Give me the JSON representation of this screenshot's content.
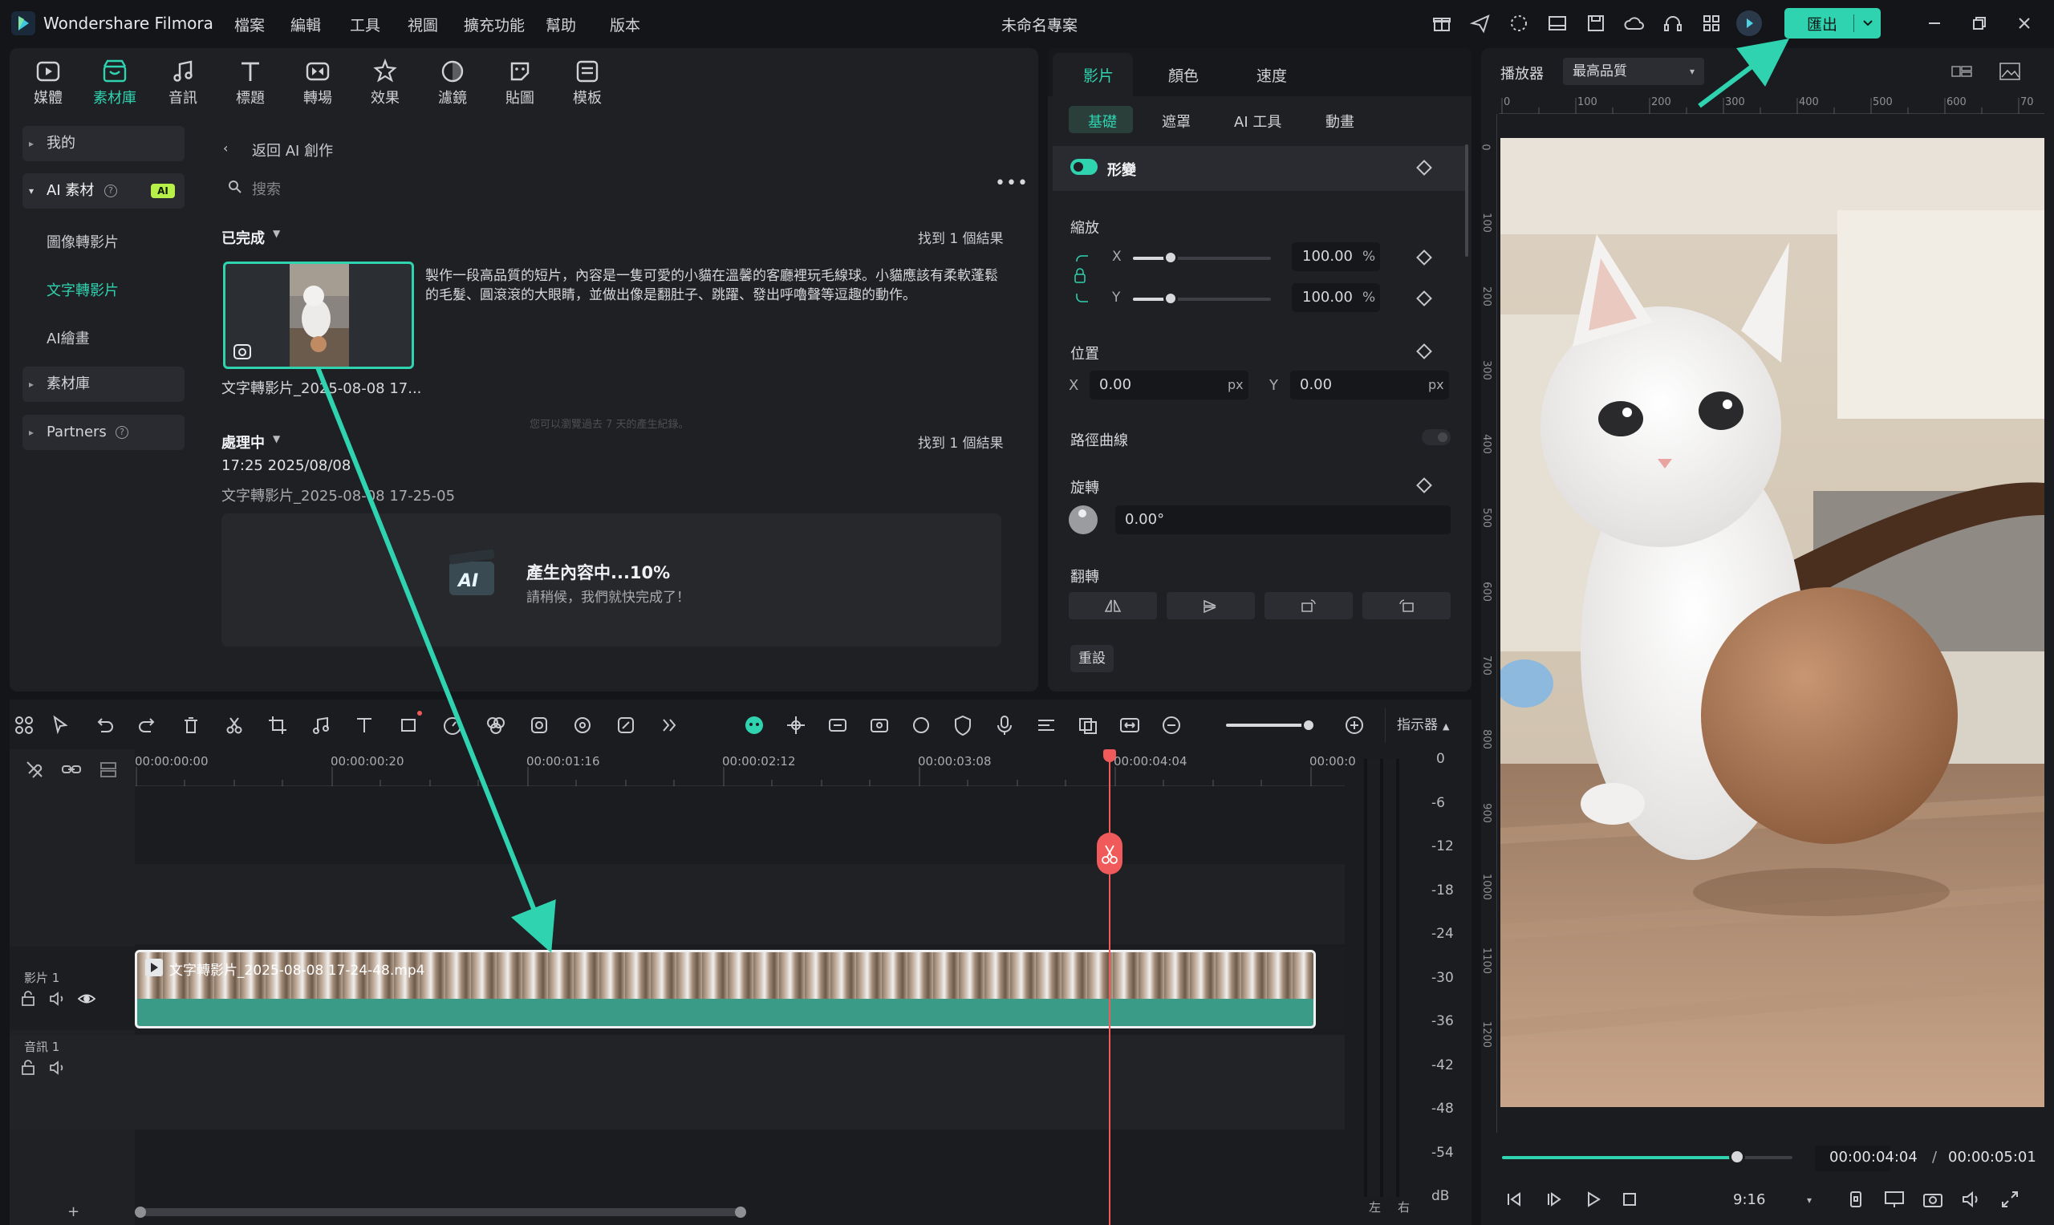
{
  "app": {
    "name": "Wondershare Filmora",
    "project_title": "未命名專案",
    "export_label": "匯出"
  },
  "menu": [
    "檔案",
    "編輯",
    "工具",
    "視圖",
    "擴充功能",
    "幫助",
    "版本"
  ],
  "toolbar": [
    {
      "label": "媒體",
      "icon": "media-icon"
    },
    {
      "label": "素材庫",
      "icon": "stock-icon",
      "active": true
    },
    {
      "label": "音訊",
      "icon": "music-icon"
    },
    {
      "label": "標題",
      "icon": "title-icon"
    },
    {
      "label": "轉場",
      "icon": "transition-icon"
    },
    {
      "label": "效果",
      "icon": "effects-icon"
    },
    {
      "label": "濾鏡",
      "icon": "filter-icon"
    },
    {
      "label": "貼圖",
      "icon": "sticker-icon"
    },
    {
      "label": "模板",
      "icon": "template-icon"
    }
  ],
  "sidebar": {
    "mine": "我的",
    "ai_assets": "AI 素材",
    "ai_badge": "AI",
    "subitems": [
      "圖像轉影片",
      "文字轉影片",
      "AI繪畫"
    ],
    "library": "素材庫",
    "partners": "Partners"
  },
  "library": {
    "back_label": "返回 AI 創作",
    "search_placeholder": "搜索",
    "completed_label": "已完成",
    "completed_count": "找到 1 個結果",
    "prompt": "製作一段高品質的短片，內容是一隻可愛的小貓在溫馨的客廳裡玩毛線球。小貓應該有柔軟蓬鬆的毛髮、圓滾滾的大眼睛，並做出像是翻肚子、跳躍、發出呼嚕聲等逗趣的動作。",
    "thumb_caption": "文字轉影片_2025-08-08 17...",
    "history_note": "您可以瀏覽過去 7 天的產生紀錄。",
    "processing_label": "處理中",
    "processing_count": "找到 1 個結果",
    "processing_time": "17:25 2025/08/08",
    "processing_name": "文字轉影片_2025-08-08 17-25-05",
    "progress_title": "產生內容中...10%",
    "progress_percent": 10,
    "progress_sub": "請稍候，我們就快完成了！",
    "ai_logo_text": "AI"
  },
  "properties": {
    "tabs": [
      "影片",
      "顏色",
      "速度"
    ],
    "subtabs": [
      "基礎",
      "遮罩",
      "AI 工具",
      "動畫"
    ],
    "transform_label": "形變",
    "scale_label": "縮放",
    "scale_x": "100.00",
    "scale_y": "100.00",
    "percent_unit": "%",
    "position_label": "位置",
    "pos_x": "0.00",
    "pos_y": "0.00",
    "px_unit": "px",
    "x_label": "X",
    "y_label": "Y",
    "path_curve_label": "路徑曲線",
    "rotation_label": "旋轉",
    "rotation_value": "0.00°",
    "flip_label": "翻轉",
    "reset_label": "重設"
  },
  "player": {
    "label": "播放器",
    "quality": "最高品質",
    "ruler": [
      "0",
      "100",
      "200",
      "300",
      "400",
      "500",
      "600",
      "70"
    ],
    "vruler": [
      "0",
      "100",
      "200",
      "300",
      "400",
      "500",
      "600",
      "700",
      "800",
      "900",
      "1000",
      "1100",
      "1200"
    ],
    "current_time": "00:00:04:04",
    "separator": "/",
    "total_time": "00:00:05:01",
    "aspect": "9:16",
    "progress": 0.81
  },
  "timeline": {
    "indicator_label": "指示器",
    "ruler": [
      "00:00:00:00",
      "00:00:00:20",
      "00:00:01:16",
      "00:00:02:12",
      "00:00:03:08",
      "00:00:04:04",
      "00:00:0"
    ],
    "video_track": "影片 1",
    "audio_track": "音訊 1",
    "clip_label": "文字轉影片_2025-08-08 17-24-48.mp4",
    "meter_labels": [
      "0",
      "-6",
      "-12",
      "-18",
      "-24",
      "-30",
      "-36",
      "-42",
      "-48",
      "-54",
      "dB"
    ],
    "meter_left": "左",
    "meter_right": "右",
    "zoom_plus": "+"
  },
  "colors": {
    "accent": "#2fd3b0",
    "playhead": "#f05a5a",
    "bg": "#141518",
    "panel": "#1f2024"
  }
}
